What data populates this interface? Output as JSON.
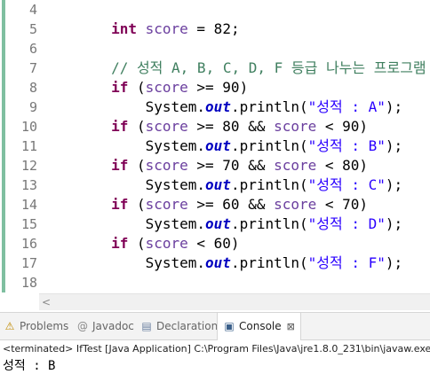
{
  "editor": {
    "line_numbers": [
      "4",
      "5",
      "6",
      "7",
      "8",
      "9",
      "10",
      "11",
      "12",
      "13",
      "14",
      "15",
      "16",
      "17",
      "18"
    ],
    "lines": [
      [],
      [
        {
          "t": "        "
        },
        {
          "t": "int",
          "c": "kw"
        },
        {
          "t": " "
        },
        {
          "t": "score",
          "c": "var"
        },
        {
          "t": " = 82;"
        }
      ],
      [],
      [
        {
          "t": "        "
        },
        {
          "t": "// 성적 A, B, C, D, F 등급 나누는 프로그램",
          "c": "cmt"
        }
      ],
      [
        {
          "t": "        "
        },
        {
          "t": "if",
          "c": "kw"
        },
        {
          "t": " ("
        },
        {
          "t": "score",
          "c": "var"
        },
        {
          "t": " >= 90)"
        }
      ],
      [
        {
          "t": "            System."
        },
        {
          "t": "out",
          "c": "fld"
        },
        {
          "t": ".println("
        },
        {
          "t": "\"성적 : A\"",
          "c": "str"
        },
        {
          "t": ");"
        }
      ],
      [
        {
          "t": "        "
        },
        {
          "t": "if",
          "c": "kw"
        },
        {
          "t": " ("
        },
        {
          "t": "score",
          "c": "var"
        },
        {
          "t": " >= 80 && "
        },
        {
          "t": "score",
          "c": "var"
        },
        {
          "t": " < 90)"
        }
      ],
      [
        {
          "t": "            System."
        },
        {
          "t": "out",
          "c": "fld"
        },
        {
          "t": ".println("
        },
        {
          "t": "\"성적 : B\"",
          "c": "str"
        },
        {
          "t": ");"
        }
      ],
      [
        {
          "t": "        "
        },
        {
          "t": "if",
          "c": "kw"
        },
        {
          "t": " ("
        },
        {
          "t": "score",
          "c": "var"
        },
        {
          "t": " >= 70 && "
        },
        {
          "t": "score",
          "c": "var"
        },
        {
          "t": " < 80)"
        }
      ],
      [
        {
          "t": "            System."
        },
        {
          "t": "out",
          "c": "fld"
        },
        {
          "t": ".println("
        },
        {
          "t": "\"성적 : C\"",
          "c": "str"
        },
        {
          "t": ");"
        }
      ],
      [
        {
          "t": "        "
        },
        {
          "t": "if",
          "c": "kw"
        },
        {
          "t": " ("
        },
        {
          "t": "score",
          "c": "var"
        },
        {
          "t": " >= 60 && "
        },
        {
          "t": "score",
          "c": "var"
        },
        {
          "t": " < 70)"
        }
      ],
      [
        {
          "t": "            System."
        },
        {
          "t": "out",
          "c": "fld"
        },
        {
          "t": ".println("
        },
        {
          "t": "\"성적 : D\"",
          "c": "str"
        },
        {
          "t": ");"
        }
      ],
      [
        {
          "t": "        "
        },
        {
          "t": "if",
          "c": "kw"
        },
        {
          "t": " ("
        },
        {
          "t": "score",
          "c": "var"
        },
        {
          "t": " < 60)"
        }
      ],
      [
        {
          "t": "            System."
        },
        {
          "t": "out",
          "c": "fld"
        },
        {
          "t": ".println("
        },
        {
          "t": "\"성적 : F\"",
          "c": "str"
        },
        {
          "t": ");"
        }
      ],
      []
    ]
  },
  "tabs": [
    {
      "label": "Problems",
      "icon": "problems-icon",
      "glyph": "⚠",
      "active": false
    },
    {
      "label": "Javadoc",
      "icon": "javadoc-icon",
      "glyph": "@",
      "active": false
    },
    {
      "label": "Declaration",
      "icon": "declaration-icon",
      "glyph": "▤",
      "active": false
    },
    {
      "label": "Console",
      "icon": "console-icon",
      "glyph": "▣",
      "active": true,
      "close": "⊠"
    }
  ],
  "console": {
    "header": "<terminated> IfTest [Java Application] C:\\Program Files\\Java\\jre1.8.0_231\\bin\\javaw.exe",
    "output": "성적 : B"
  },
  "scrollbar": {
    "left_arrow": "<"
  },
  "colors": {
    "keyword": "#7f0055",
    "variable": "#6a3e9e",
    "field": "#0000c0",
    "string": "#2a00ff",
    "comment": "#3f7f5f",
    "line_number": "#787878"
  }
}
